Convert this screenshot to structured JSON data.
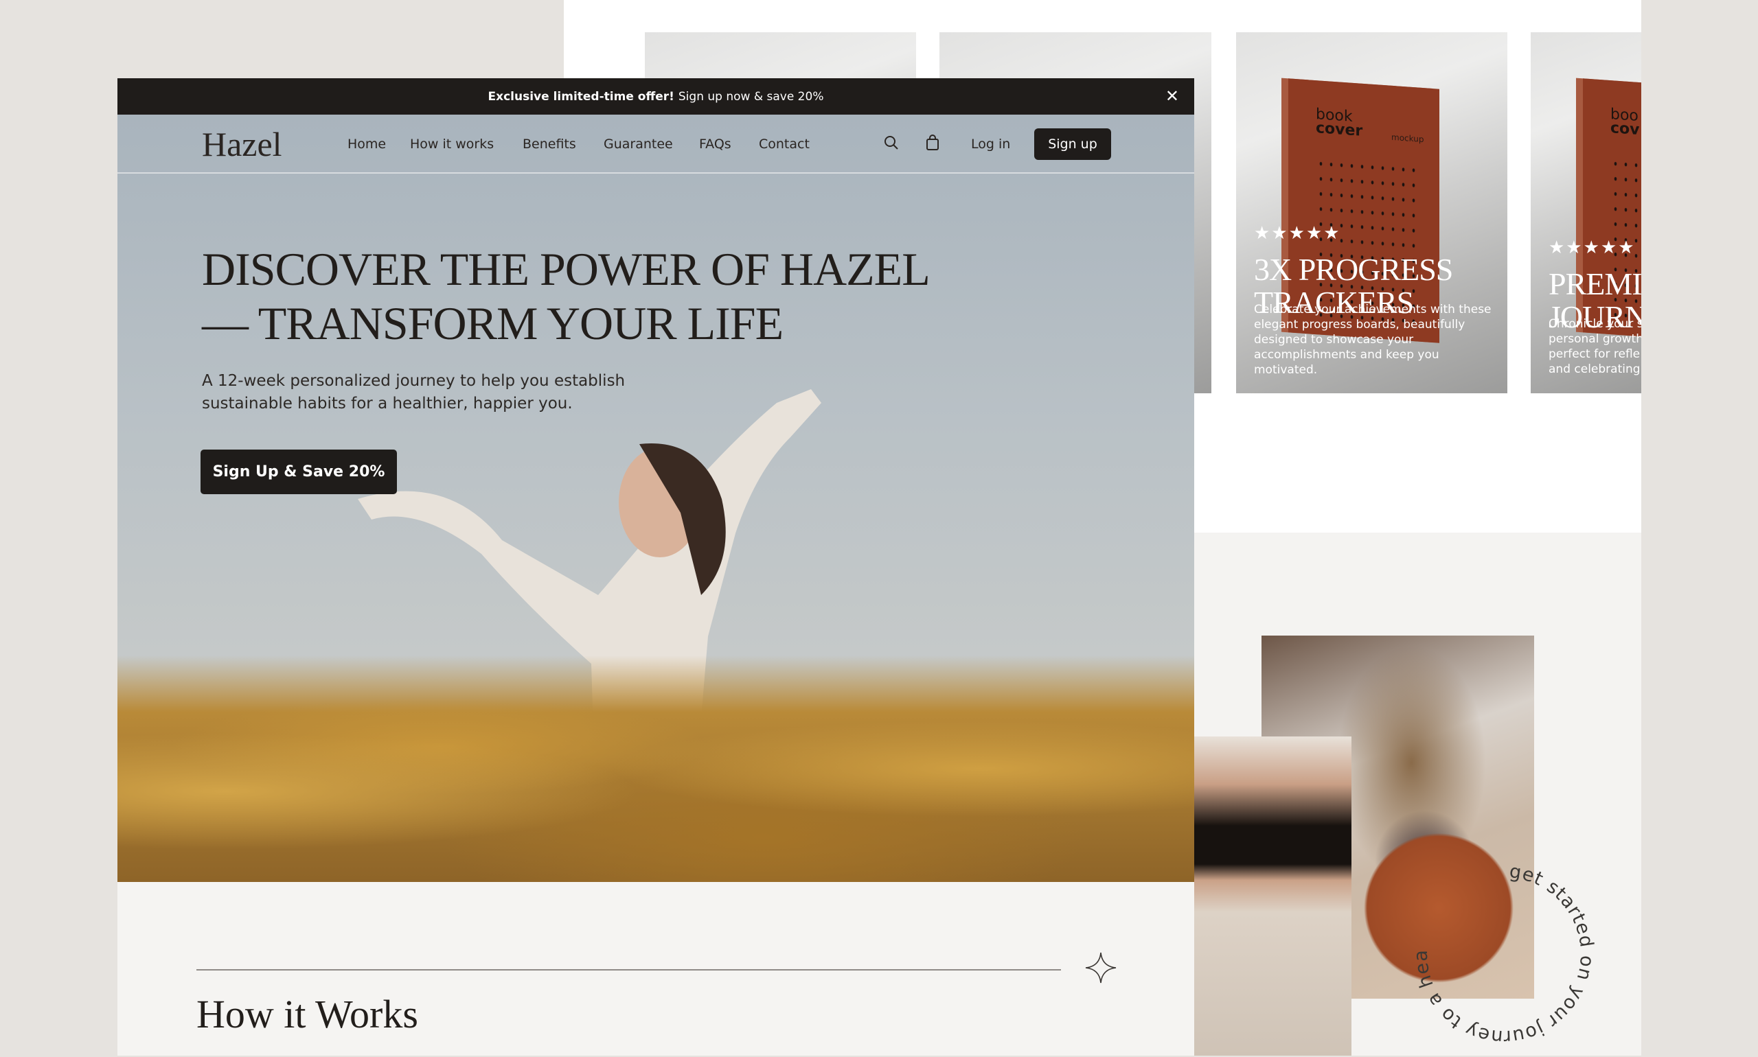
{
  "banner": {
    "offer_bold": "Exclusive limited-time offer!",
    "offer_text": "Sign up now & save 20%",
    "close_icon": "close-icon"
  },
  "nav": {
    "logo": "Hazel",
    "items": [
      {
        "label": "Home"
      },
      {
        "label": "How it works"
      },
      {
        "label": "Benefits"
      },
      {
        "label": "Guarantee"
      },
      {
        "label": "FAQs"
      },
      {
        "label": "Contact"
      }
    ],
    "search_icon": "search-icon",
    "cart_icon": "shopping-bag-icon",
    "login": "Log in",
    "signup": "Sign up"
  },
  "hero": {
    "headline_line1": "DISCOVER THE POWER OF HAZEL",
    "headline_line2": "— TRANSFORM YOUR LIFE",
    "subtext": "A 12-week personalized journey to help you establish sustainable habits for a healthier, happier you.",
    "cta": "Sign Up & Save 20%"
  },
  "how_it_works": {
    "title": "How it Works"
  },
  "cards": [
    {
      "rating": 5,
      "stars": "★★★★★",
      "title_line1": "3X PROGRESS",
      "title_line2": "TRACKERS",
      "description": "Celebrate your achievements with these elegant progress boards, beautifully designed to showcase your accomplishments and keep you motivated.",
      "book_word1": "book",
      "book_word2": "cover",
      "book_word3": "mockup"
    },
    {
      "rating": 5,
      "stars": "★★★★★",
      "title_line1": "PREMIU",
      "title_line2": "JOURN/",
      "description": "Chronicle your s personal growth perfect for refle and celebrating",
      "book_word1": "boo",
      "book_word2": "cov"
    }
  ],
  "circular_text": "get started on your journey to a healthier you · ",
  "colors": {
    "dark": "#1f1c1a",
    "sky": "#aab5be",
    "gold": "#c8963a",
    "page_bg": "#e6e3df"
  }
}
